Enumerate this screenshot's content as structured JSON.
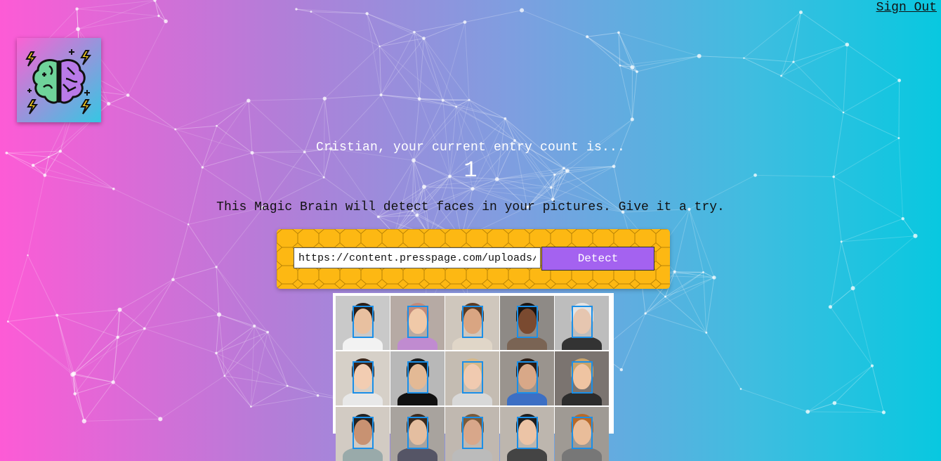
{
  "nav": {
    "signout_label": "Sign Out"
  },
  "logo": {
    "icon": "brain-icon",
    "colors": {
      "left_lobe": "#6fd39a",
      "right_lobe": "#b97ae8",
      "bolt": "#ffd21f"
    }
  },
  "rank": {
    "text": "Cristian, your current entry count is...",
    "count": "1"
  },
  "intro": {
    "text": "This Magic Brain will detect faces in your pictures. Give it a try."
  },
  "form": {
    "input_value": "https://content.presspage.com/uploads/",
    "button_label": "Detect"
  },
  "image": {
    "description_icon": "faces-collage-image",
    "rows": 3,
    "cols": 5,
    "faces_detected": 15
  },
  "colors": {
    "gradient_start": "#fd5bd6",
    "gradient_end": "#08c8e0",
    "panel": "#fdb813",
    "button": "#a462f0",
    "bounding_box": "#1a8fe8"
  }
}
